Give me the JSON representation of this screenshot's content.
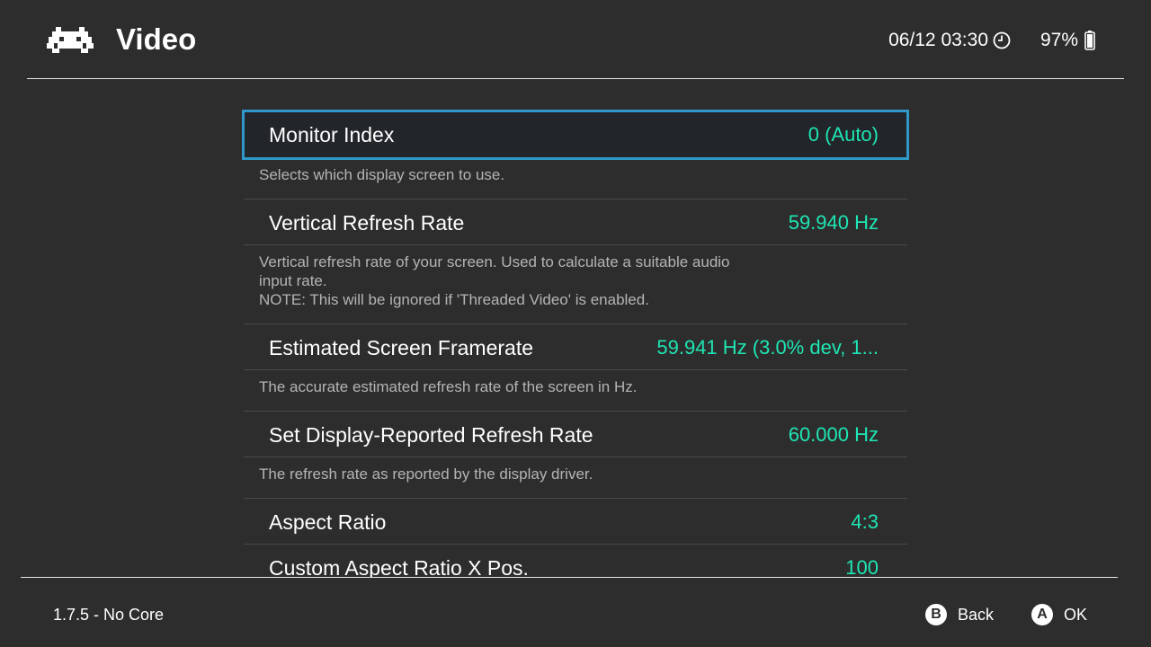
{
  "header": {
    "title": "Video",
    "logo_icon": "retroarch-invader-icon",
    "datetime": "06/12 03:30",
    "battery": "97%"
  },
  "items": [
    {
      "label": "Monitor Index",
      "value": "0 (Auto)",
      "selected": true,
      "description": [
        "Selects which display screen to use."
      ]
    },
    {
      "label": "Vertical Refresh Rate",
      "value": "59.940 Hz",
      "description": [
        "Vertical refresh rate of your screen. Used to calculate a suitable audio",
        "input rate.",
        "NOTE: This will be ignored if 'Threaded Video' is enabled."
      ]
    },
    {
      "label": "Estimated Screen Framerate",
      "value": "59.941 Hz (3.0% dev, 1...",
      "description": [
        "The accurate estimated refresh rate of the screen in Hz."
      ]
    },
    {
      "label": "Set Display-Reported Refresh Rate",
      "value": "60.000 Hz",
      "description": [
        "The refresh rate as reported by the display driver."
      ]
    },
    {
      "label": "Aspect Ratio",
      "value": "4:3",
      "description": []
    },
    {
      "label": "Custom Aspect Ratio X Pos.",
      "value": "100",
      "description": []
    }
  ],
  "footer": {
    "version": "1.7.5 - No Core",
    "hints": [
      {
        "button": "B",
        "label": "Back"
      },
      {
        "button": "A",
        "label": "OK"
      }
    ]
  },
  "colors": {
    "background": "#2d2d2d",
    "accent_value": "#1ee6b4",
    "selection_border": "#2f98c8",
    "description_text": "#b4b4b4"
  }
}
